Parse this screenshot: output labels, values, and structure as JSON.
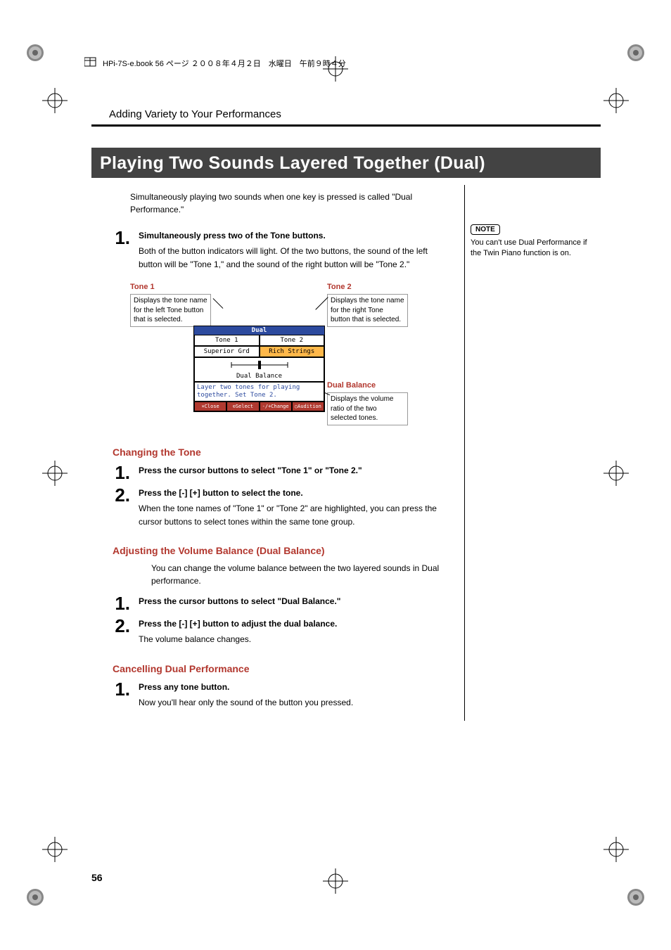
{
  "book_header": "HPi-7S-e.book  56 ページ  ２００８年４月２日　水曜日　午前９時４分",
  "section_header": "Adding Variety to Your Performances",
  "main_title": "Playing Two Sounds Layered Together (Dual)",
  "intro": "Simultaneously playing two sounds when one key is pressed is called \"Dual Performance.\"",
  "note": {
    "label": "NOTE",
    "text": "You can't use Dual Performance if the Twin Piano function is on."
  },
  "setup_step": {
    "num": "1.",
    "title": "Simultaneously press two of the Tone buttons.",
    "text": "Both of the button indicators will light. Of the two buttons, the sound of the left button will be \"Tone 1,\" and the sound of the right button will be \"Tone 2.\""
  },
  "diagram": {
    "tone1": {
      "title": "Tone 1",
      "text": "Displays the tone name for the left Tone button that is selected."
    },
    "tone2": {
      "title": "Tone 2",
      "text": "Displays the tone name for the right Tone button that is selected."
    },
    "dual_balance": {
      "title": "Dual Balance",
      "text": "Displays the volume ratio of the two selected tones."
    },
    "device": {
      "header": "Dual",
      "tone1_label": "Tone 1",
      "tone2_label": "Tone 2",
      "tone1_value": "Superior Grd",
      "tone2_value": "Rich Strings",
      "balance_label": "Dual Balance",
      "hint": "Layer two tones for playing together. Set Tone 2.",
      "buttons": {
        "close": "×Close",
        "select": "⊙Select",
        "change": "-/+Change",
        "audition": "○Audition"
      }
    }
  },
  "changing_tone": {
    "heading": "Changing the Tone",
    "step1": {
      "num": "1.",
      "title": "Press the cursor buttons to select \"Tone 1\" or \"Tone 2.\""
    },
    "step2": {
      "num": "2.",
      "title": "Press the [-] [+] button to select the tone.",
      "text": "When the tone names of \"Tone 1\" or \"Tone 2\" are highlighted, you can press the cursor buttons to select tones within the same tone group."
    }
  },
  "dual_balance": {
    "heading": "Adjusting the Volume Balance (Dual Balance)",
    "intro": "You can change the volume balance between the two layered sounds in Dual performance.",
    "step1": {
      "num": "1.",
      "title": "Press the cursor buttons to select \"Dual Balance.\""
    },
    "step2": {
      "num": "2.",
      "title": "Press the [-] [+] button to adjust the dual balance.",
      "text": "The volume balance changes."
    }
  },
  "cancelling": {
    "heading": "Cancelling Dual Performance",
    "step1": {
      "num": "1.",
      "title": "Press any tone button.",
      "text": "Now you'll hear only the sound of the button you pressed."
    }
  },
  "page_number": "56"
}
